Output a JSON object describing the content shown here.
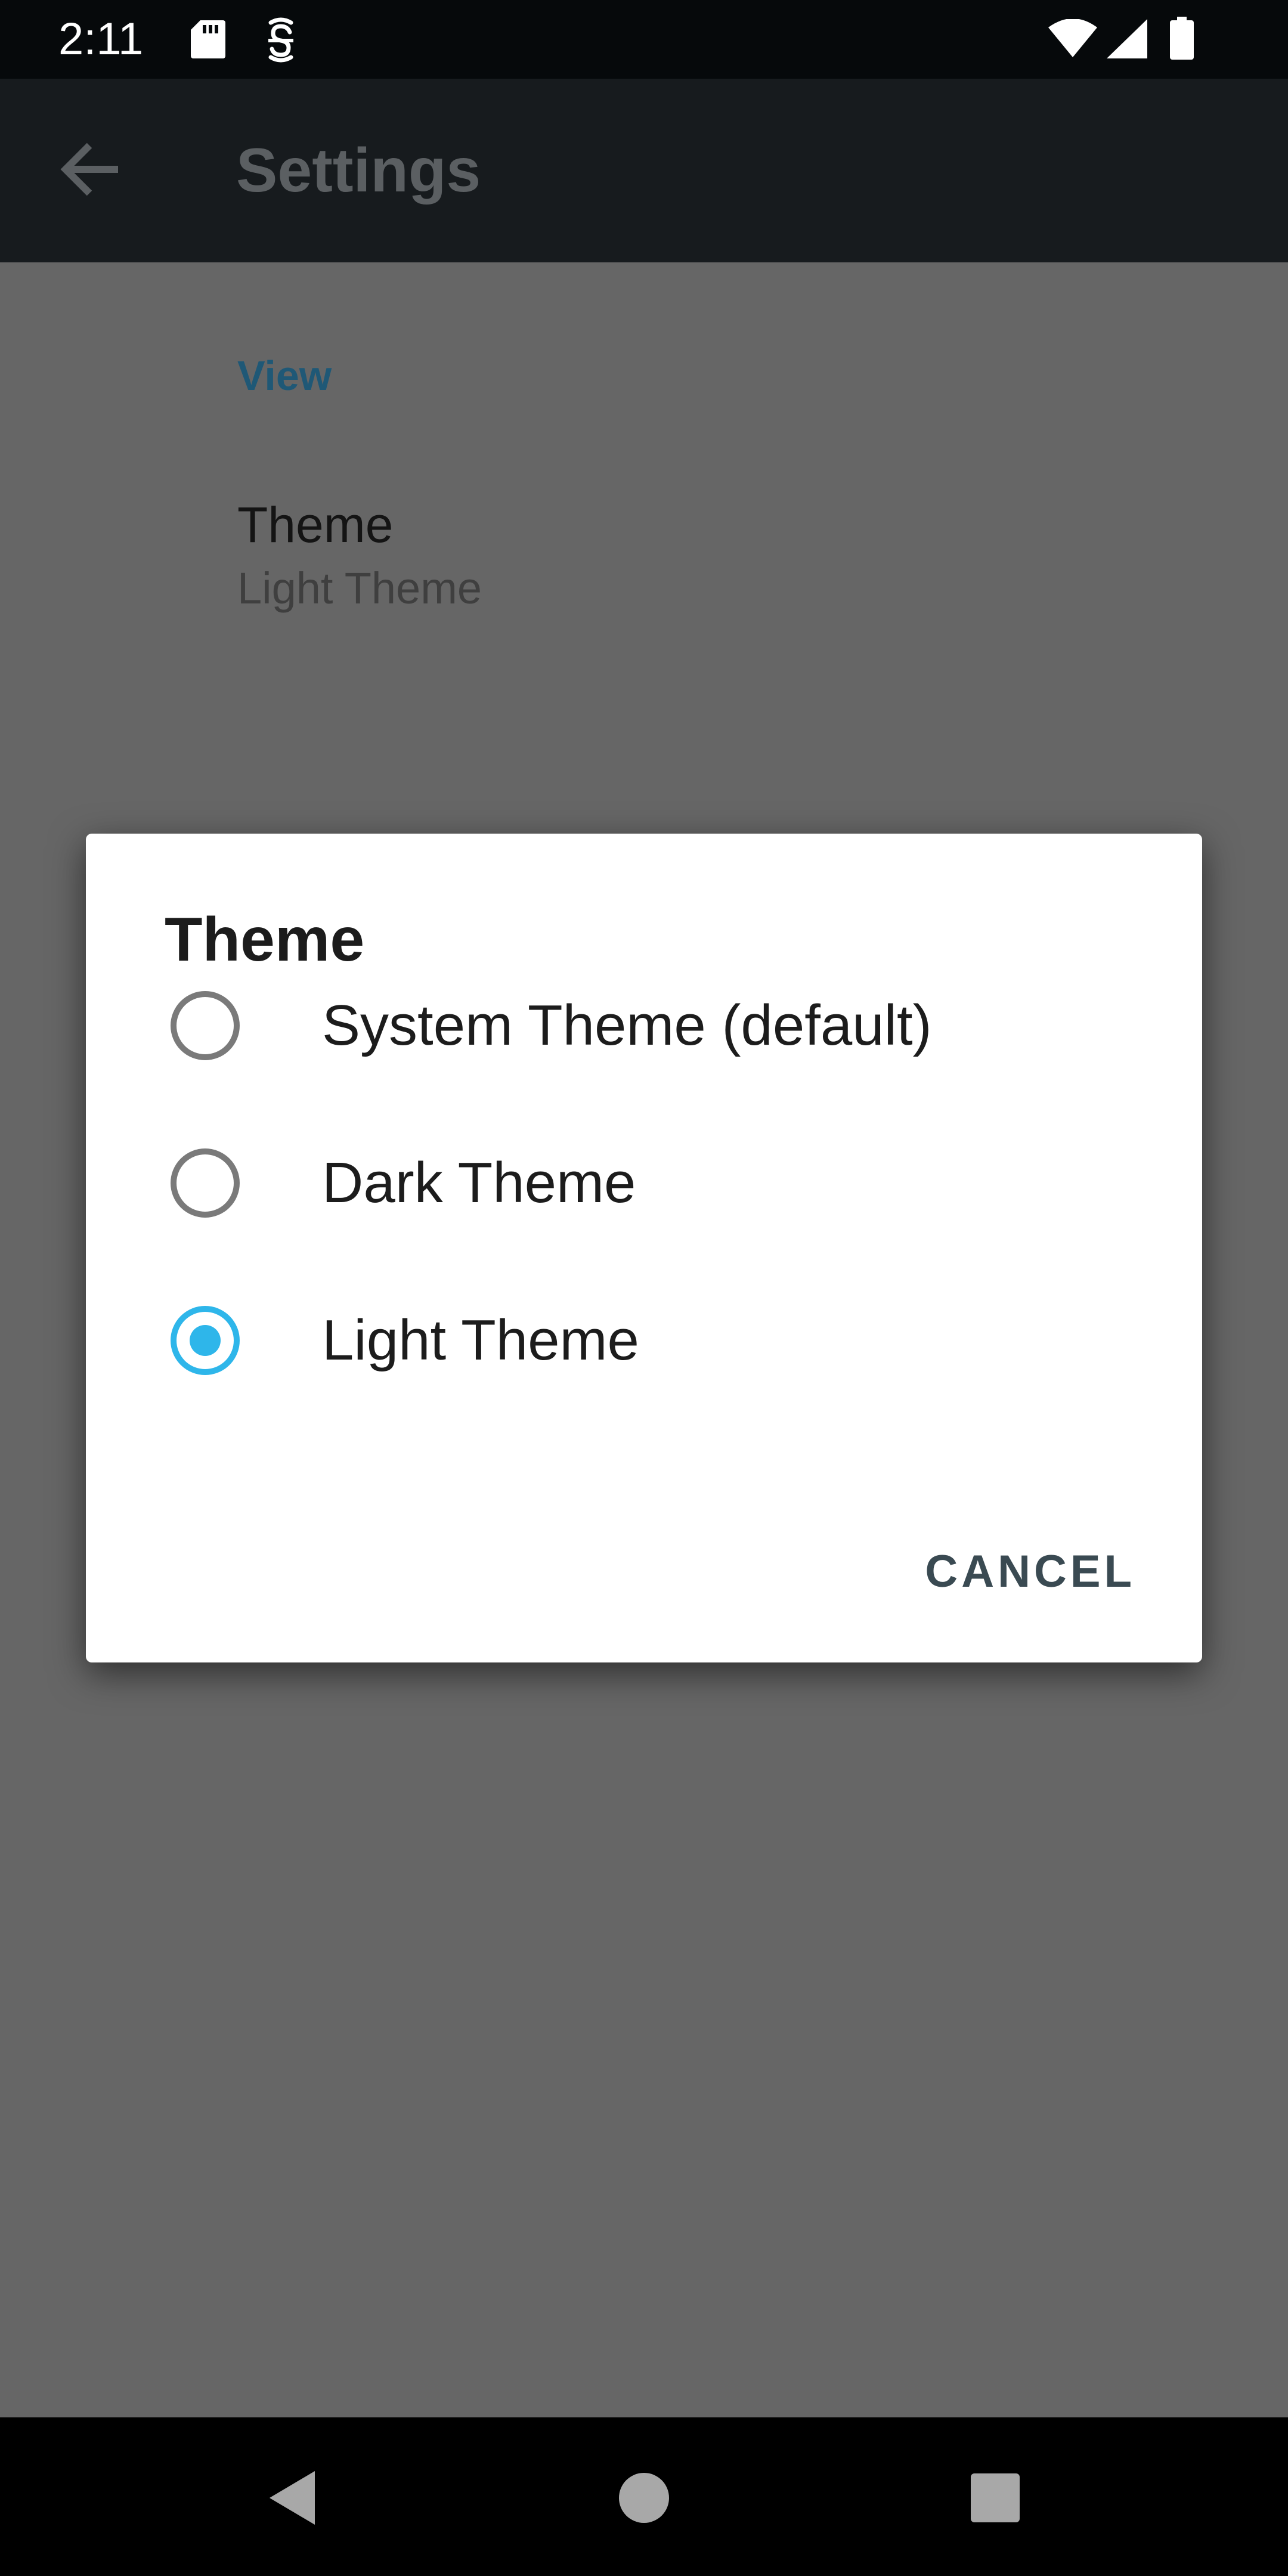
{
  "status_bar": {
    "time": "2:11",
    "icons": [
      "sd-card-icon",
      "notification-app-icon",
      "wifi-icon",
      "cellular-signal-icon",
      "battery-icon"
    ]
  },
  "app_bar": {
    "title": "Settings",
    "back_icon": "arrow-back-icon"
  },
  "settings": {
    "section_header": "View",
    "theme_pref": {
      "title": "Theme",
      "summary": "Light Theme"
    }
  },
  "dialog": {
    "title": "Theme",
    "options": [
      {
        "label": "System Theme (default)",
        "selected": false
      },
      {
        "label": "Dark Theme",
        "selected": false
      },
      {
        "label": "Light Theme",
        "selected": true
      }
    ],
    "cancel_label": "CANCEL"
  },
  "nav_bar": {
    "icons": [
      "nav-back-icon",
      "nav-home-icon",
      "nav-recents-icon"
    ]
  },
  "colors": {
    "accent": "#2eb6ea",
    "scrim": "#666666",
    "section_header": "#1f5876",
    "dialog_bg": "#ffffff"
  }
}
